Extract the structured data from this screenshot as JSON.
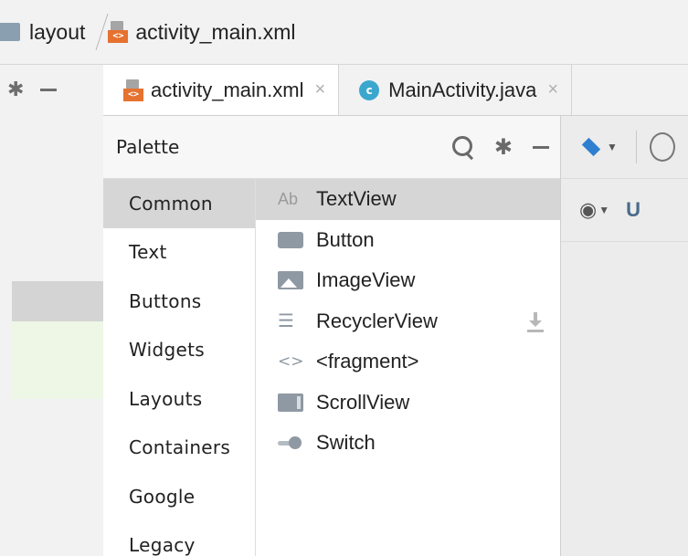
{
  "breadcrumb": {
    "items": [
      {
        "label": "layout",
        "icon": "folder-icon"
      },
      {
        "label": "activity_main.xml",
        "icon": "xml-file-icon"
      }
    ]
  },
  "left_panel": {
    "toolbar_icons": [
      "gear-icon",
      "minimize-icon"
    ]
  },
  "tabs": [
    {
      "label": "activity_main.xml",
      "icon": "xml-file-icon",
      "active": true,
      "close": "×"
    },
    {
      "label": "MainActivity.java",
      "icon": "java-class-icon",
      "icon_letter": "c",
      "active": false,
      "close": "×"
    }
  ],
  "palette": {
    "title": "Palette",
    "header_icons": [
      "search-icon",
      "gear-icon",
      "minimize-icon"
    ],
    "categories": [
      {
        "label": "Common",
        "selected": true
      },
      {
        "label": "Text"
      },
      {
        "label": "Buttons"
      },
      {
        "label": "Widgets"
      },
      {
        "label": "Layouts"
      },
      {
        "label": "Containers"
      },
      {
        "label": "Google"
      },
      {
        "label": "Legacy"
      }
    ],
    "widgets": [
      {
        "label": "TextView",
        "icon": "textview-icon",
        "icon_text": "Ab",
        "selected": true
      },
      {
        "label": "Button",
        "icon": "button-icon"
      },
      {
        "label": "ImageView",
        "icon": "imageview-icon"
      },
      {
        "label": "RecyclerView",
        "icon": "recyclerview-icon",
        "icon_text": "☰",
        "download": true
      },
      {
        "label": "<fragment>",
        "icon": "fragment-icon",
        "icon_text": "<>"
      },
      {
        "label": "ScrollView",
        "icon": "scrollview-icon"
      },
      {
        "label": "Switch",
        "icon": "switch-icon"
      }
    ]
  },
  "design_toolbar": {
    "row1": [
      "layers-icon",
      "orientation-icon"
    ],
    "row2": [
      "eye-icon",
      "magnet-icon"
    ]
  },
  "colors": {
    "accent_blue": "#2f7fd1",
    "xml_orange": "#e67230",
    "java_cyan": "#3ba7cf",
    "selection_gray": "#d6d6d6"
  }
}
